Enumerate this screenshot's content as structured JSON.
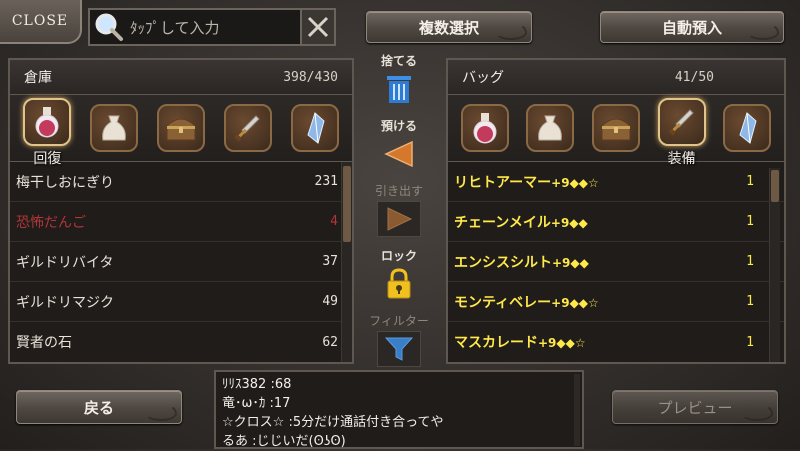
{
  "top": {
    "close_label": "CLOSE",
    "search_placeholder": "ﾀｯﾌﾟして入力",
    "multi_select_label": "複数選択",
    "auto_deposit_label": "自動預入"
  },
  "storage": {
    "title": "倉庫",
    "count": "398/430",
    "active_category_label": "回復",
    "categories": [
      "potion-icon",
      "bag-icon",
      "chest-icon",
      "sword-icon",
      "crystal-icon"
    ],
    "items": [
      {
        "name": "梅干しおにぎり",
        "qty": "231",
        "warn": false
      },
      {
        "name": "恐怖だんご",
        "qty": "4",
        "warn": true
      },
      {
        "name": "ギルドリバイタ",
        "qty": "37",
        "warn": false
      },
      {
        "name": "ギルドリマジク",
        "qty": "49",
        "warn": false
      },
      {
        "name": "賢者の石",
        "qty": "62",
        "warn": false
      }
    ]
  },
  "middle": {
    "discard_label": "捨てる",
    "deposit_label": "預ける",
    "withdraw_label": "引き出す",
    "lock_label": "ロック",
    "filter_label": "フィルター"
  },
  "bag": {
    "title": "バッグ",
    "count": "41/50",
    "active_category_label": "装備",
    "categories": [
      "potion-icon",
      "bag-icon",
      "chest-icon",
      "sword-icon",
      "crystal-icon"
    ],
    "items": [
      {
        "name": "リヒトアーマー",
        "plus": "+9◆◆☆",
        "qty": "1"
      },
      {
        "name": "チェーンメイル",
        "plus": "+9◆◆",
        "qty": "1"
      },
      {
        "name": "エンシスシルト",
        "plus": "+9◆◆",
        "qty": "1"
      },
      {
        "name": "モンティベレー",
        "plus": "+9◆◆☆",
        "qty": "1"
      },
      {
        "name": "マスカレード",
        "plus": "+9◆◆☆",
        "qty": "1"
      }
    ]
  },
  "bottom": {
    "back_label": "戻る",
    "preview_label": "プレビュー"
  },
  "chat": {
    "lines": [
      "ﾘﾘｽ382  :68",
      "竜･ω･ｶ  :17",
      "☆クロス☆  :5分だけ通話付き合ってや",
      "るあ  :じじいだ(ʘʖʘ)"
    ]
  },
  "colors": {
    "item_yellow": "#ffe84a",
    "warn_red": "#b0363a",
    "trash_blue": "#2e7bd6",
    "lock_gold": "#f0c020"
  }
}
